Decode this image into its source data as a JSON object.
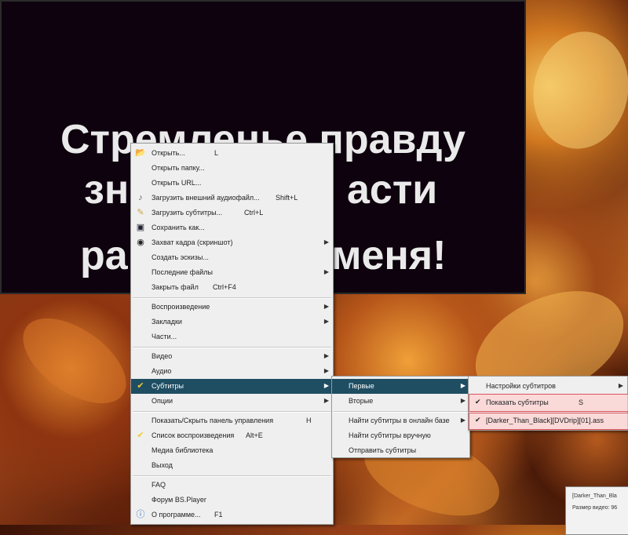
{
  "subtitle": {
    "line1": "Стремленье правду",
    "line2_left": "зн",
    "line2_right": "асти",
    "line3_left": "ра",
    "line3_right": "меня!"
  },
  "main_menu": [
    {
      "label": "Открыть...",
      "shortcut": "L",
      "icon": "open-folder-icon"
    },
    {
      "label": "Открыть папку..."
    },
    {
      "label": "Открыть URL..."
    },
    {
      "label": "Загрузить внешний аудиофайл...",
      "shortcut": "Shift+L",
      "icon": "audio-load-icon"
    },
    {
      "label": "Загрузить субтитры...",
      "shortcut": "Ctrl+L",
      "icon": "subtitle-load-icon"
    },
    {
      "label": "Сохранить как...",
      "icon": "save-icon"
    },
    {
      "label": "Захват кадра (скриншот)",
      "icon": "camera-icon"
    },
    {
      "label": "Создать эскизы..."
    },
    {
      "label": "Последние файлы"
    },
    {
      "label": "Закрыть файл",
      "shortcut": "Ctrl+F4"
    },
    {
      "label": "Воспроизведение"
    },
    {
      "label": "Закладки"
    },
    {
      "label": "Части..."
    },
    {
      "label": "Видео"
    },
    {
      "label": "Аудио"
    },
    {
      "label": "Субтитры",
      "icon": "subtitles-icon"
    },
    {
      "label": "Опции"
    },
    {
      "label": "Показать/Скрыть панель управления",
      "shortcut": "H"
    },
    {
      "label": "Список воспроизведения",
      "shortcut": "Alt+E",
      "icon": "playlist-icon"
    },
    {
      "label": "Медиа библиотека"
    },
    {
      "label": "Выход"
    },
    {
      "label": "FAQ"
    },
    {
      "label": "Форум BS.Player"
    },
    {
      "label": "О программе...",
      "shortcut": "F1",
      "icon": "info-icon"
    }
  ],
  "sub_menu": [
    {
      "label": "Первые"
    },
    {
      "label": "Вторые"
    },
    {
      "label": "Найти субтитры в онлайн базе"
    },
    {
      "label": "Найти субтитры вручную"
    },
    {
      "label": "Отправить субтитры"
    }
  ],
  "third_menu": [
    {
      "label": "Настройки субтитров"
    },
    {
      "label": "Показать субтитры",
      "shortcut": "S"
    },
    {
      "label": "[Darker_Than_Black][DVDrip][01].ass"
    }
  ],
  "info_box": {
    "line1": "[Darker_Than_Bla",
    "line2": "Размер видео: 96"
  },
  "colors": {
    "highlight": "#1f4e63",
    "red_outline": "#d9555b"
  }
}
